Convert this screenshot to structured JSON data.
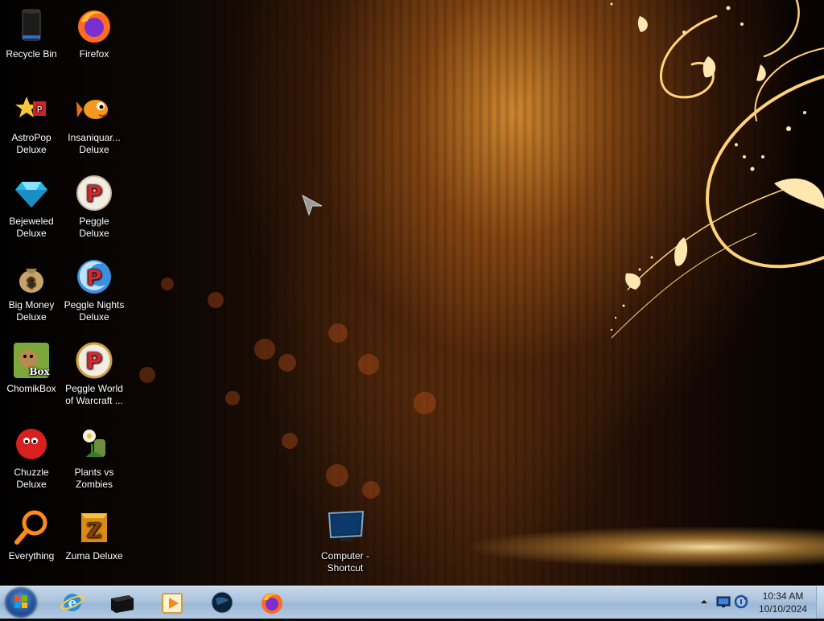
{
  "desktop": {
    "icons": [
      {
        "label": "Recycle Bin"
      },
      {
        "label": "Firefox"
      },
      {
        "label": "AstroPop Deluxe"
      },
      {
        "label": "Insaniquar... Deluxe"
      },
      {
        "label": "Bejeweled Deluxe"
      },
      {
        "label": "Peggle Deluxe"
      },
      {
        "label": "Big Money Deluxe"
      },
      {
        "label": "Peggle Nights Deluxe"
      },
      {
        "label": "ChomikBox"
      },
      {
        "label": "Peggle World of Warcraft ..."
      },
      {
        "label": "Chuzzle Deluxe"
      },
      {
        "label": "Plants vs Zombies"
      },
      {
        "label": "Everything"
      },
      {
        "label": "Zuma Deluxe"
      },
      {
        "label": "Computer - Shortcut"
      }
    ]
  },
  "taskbar": {
    "pinned": [
      {
        "icon": "internet-explorer-icon"
      },
      {
        "icon": "black-box-icon"
      },
      {
        "icon": "media-player-icon"
      },
      {
        "icon": "globe-icon"
      },
      {
        "icon": "firefox-icon"
      }
    ],
    "tray": {
      "time": "10:34 AM",
      "date": "10/10/2024"
    }
  },
  "colors": {
    "taskbar": "#aac3dd",
    "icon_text": "#ffffff"
  }
}
